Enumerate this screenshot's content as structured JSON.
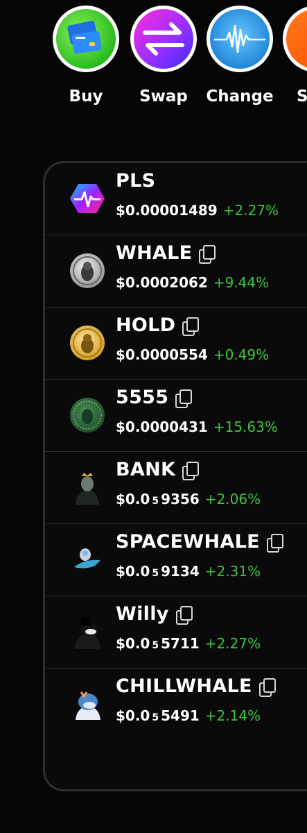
{
  "actions": [
    {
      "label": "Buy",
      "icon": "credit-card-icon"
    },
    {
      "label": "Swap",
      "icon": "swap-arrows-icon"
    },
    {
      "label": "Change",
      "icon": "pulse-wave-icon"
    },
    {
      "label": "S",
      "icon": "partial-action-icon"
    }
  ],
  "tokens": [
    {
      "name": "PLS",
      "price": "$0.00001489",
      "change": "+2.27%",
      "copy": false
    },
    {
      "name": "WHALE",
      "price": "$0.0002062",
      "change": "+9.44%",
      "copy": true
    },
    {
      "name": "HOLD",
      "price": "$0.0000554",
      "change": "+0.49%",
      "copy": true
    },
    {
      "name": "5555",
      "price": "$0.0000431",
      "change": "+15.63%",
      "copy": true
    },
    {
      "name": "BANK",
      "price_prefix": "$0.0",
      "price_sub": "5",
      "price_rest": "9356",
      "change": "+2.06%",
      "copy": true
    },
    {
      "name": "SPACEWHALE",
      "price_prefix": "$0.0",
      "price_sub": "5",
      "price_rest": "9134",
      "change": "+2.31%",
      "copy": true
    },
    {
      "name": "Willy",
      "price_prefix": "$0.0",
      "price_sub": "5",
      "price_rest": "5711",
      "change": "+2.27%",
      "copy": true
    },
    {
      "name": "CHILLWHALE",
      "price_prefix": "$0.0",
      "price_sub": "5",
      "price_rest": "5491",
      "change": "+2.14%",
      "copy": true
    }
  ],
  "colors": {
    "positive": "#3fc43f",
    "background": "#050505",
    "card_border": "#2e2e2e"
  }
}
